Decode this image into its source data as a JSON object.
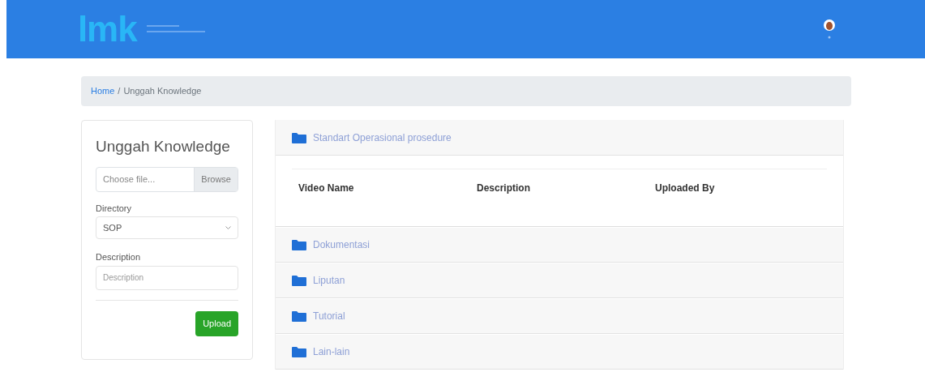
{
  "header": {
    "logo": "lmk"
  },
  "breadcrumb": {
    "separator": "/",
    "items": [
      {
        "label": "Home",
        "link": true
      },
      {
        "label": "Unggah Knowledge",
        "link": false
      }
    ]
  },
  "upload_form": {
    "title": "Unggah Knowledge",
    "file": {
      "placeholder": "Choose file...",
      "button": "Browse"
    },
    "directory": {
      "label": "Directory",
      "value": "SOP"
    },
    "description": {
      "label": "Description",
      "placeholder": "Description"
    },
    "submit": "Upload"
  },
  "folders": [
    {
      "name": "Standart Operasional prosedure",
      "expanded": true,
      "columns": [
        "Video Name",
        "Description",
        "Uploaded By"
      ]
    },
    {
      "name": "Dokumentasi",
      "expanded": false
    },
    {
      "name": "Liputan",
      "expanded": false
    },
    {
      "name": "Tutorial",
      "expanded": false
    },
    {
      "name": "Lain-lain",
      "expanded": false
    }
  ]
}
